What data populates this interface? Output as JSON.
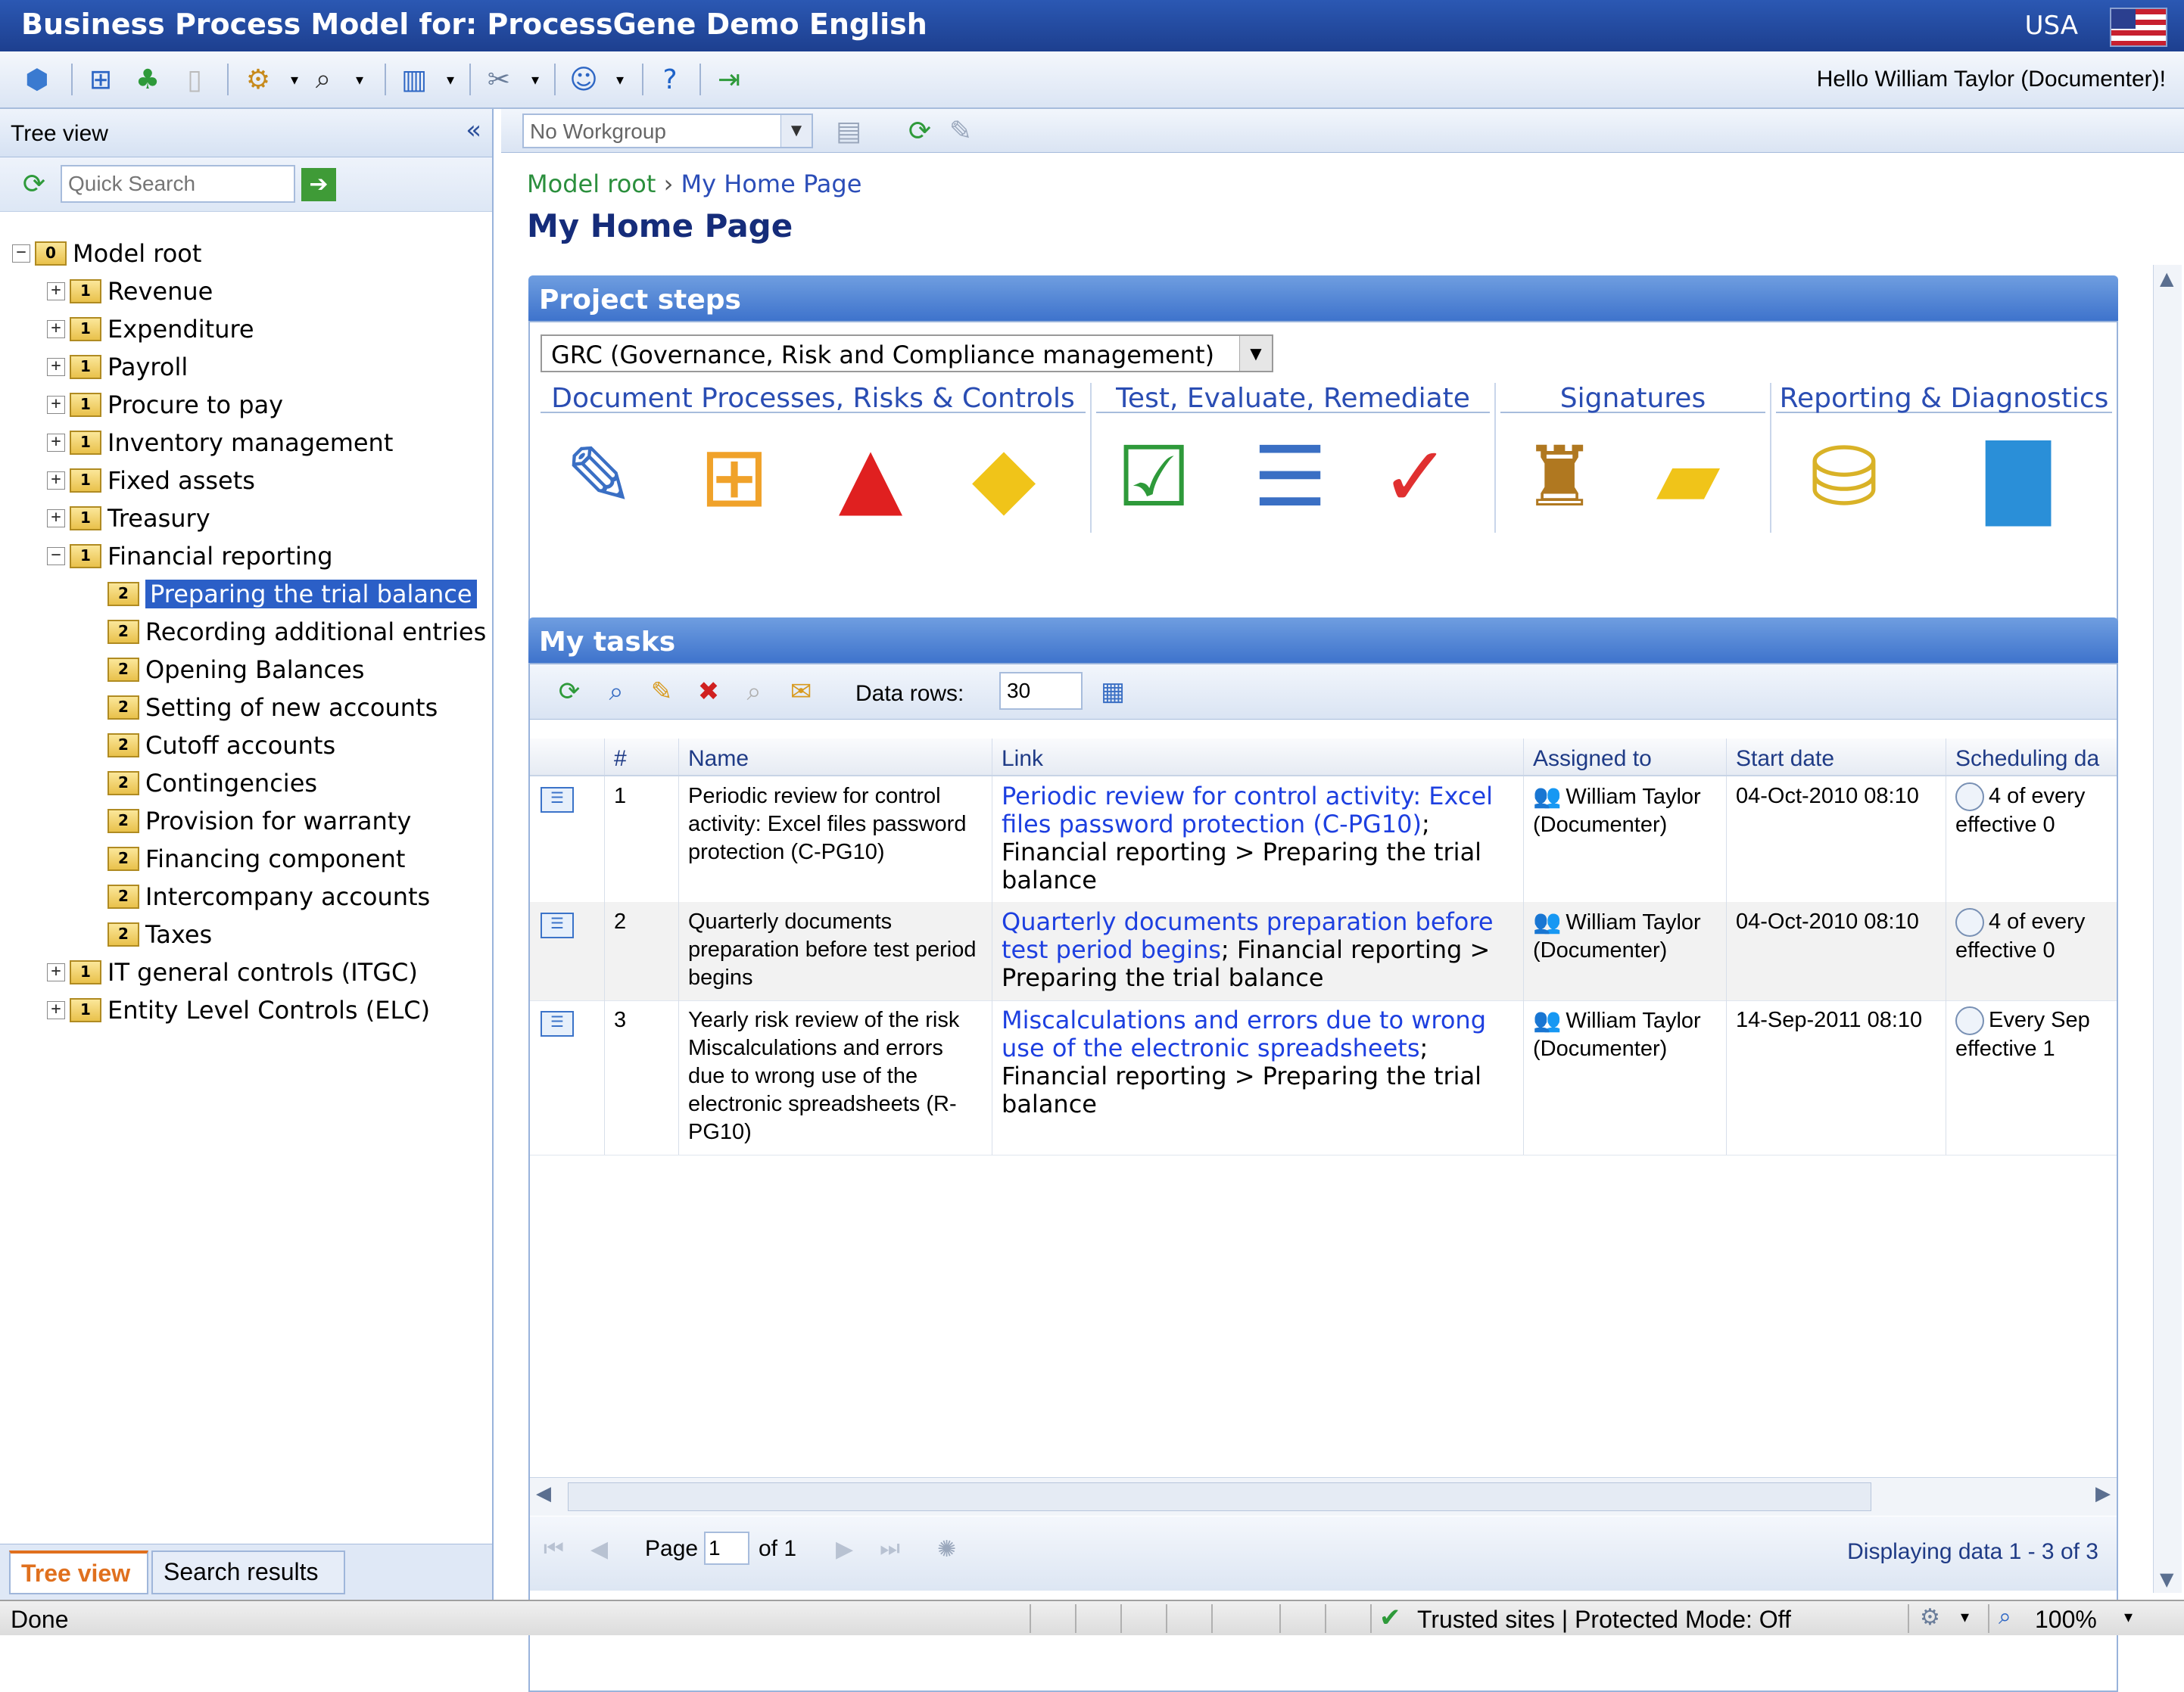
{
  "window": {
    "title": "Business Process Model for: ProcessGene Demo English",
    "locale": "USA",
    "greeting": "Hello William Taylor (Documenter)!"
  },
  "tree": {
    "header": "Tree view",
    "collapse_icon": "«",
    "quick_search_placeholder": "Quick Search",
    "root": {
      "label": "Model root",
      "level": "0"
    },
    "level1": [
      {
        "label": "Revenue",
        "level": "1"
      },
      {
        "label": "Expenditure",
        "level": "1"
      },
      {
        "label": "Payroll",
        "level": "1"
      },
      {
        "label": "Procure to pay",
        "level": "1"
      },
      {
        "label": "Inventory management",
        "level": "1"
      },
      {
        "label": "Fixed assets",
        "level": "1"
      },
      {
        "label": "Treasury",
        "level": "1"
      },
      {
        "label": "Financial reporting",
        "level": "1"
      }
    ],
    "financial_children": [
      {
        "label": "Preparing the trial balance",
        "level": "2"
      },
      {
        "label": "Recording additional entries",
        "level": "2"
      },
      {
        "label": "Opening Balances",
        "level": "2"
      },
      {
        "label": "Setting of new accounts",
        "level": "2"
      },
      {
        "label": "Cutoff accounts",
        "level": "2"
      },
      {
        "label": "Contingencies",
        "level": "2"
      },
      {
        "label": "Provision for warranty",
        "level": "2"
      },
      {
        "label": "Financing component",
        "level": "2"
      },
      {
        "label": "Intercompany accounts",
        "level": "2"
      },
      {
        "label": "Taxes",
        "level": "2"
      }
    ],
    "level1_tail": [
      {
        "label": "IT general controls (ITGC)",
        "level": "1"
      },
      {
        "label": "Entity Level Controls (ELC)",
        "level": "1"
      }
    ],
    "tabs": {
      "tree": "Tree view",
      "search": "Search results"
    }
  },
  "workgroup": {
    "value": "No Workgroup"
  },
  "breadcrumb": {
    "root": "Model root",
    "sep": "›",
    "current": "My Home Page"
  },
  "page_title": "My Home Page",
  "project_steps": {
    "header": "Project steps",
    "selected_method": "GRC (Governance, Risk and Compliance management)",
    "groups": [
      "Document Processes, Risks & Controls",
      "Test, Evaluate, Remediate",
      "Signatures",
      "Reporting & Diagnostics"
    ]
  },
  "tasks": {
    "header": "My tasks",
    "data_rows_label": "Data rows:",
    "data_rows_value": "30",
    "columns": [
      "#",
      "Name",
      "Link",
      "Assigned to",
      "Start date",
      "Scheduling da"
    ],
    "rows": [
      {
        "num": "1",
        "name": "Periodic review for control activity: Excel files password protection (C-PG10)",
        "link_text": "Periodic review for control activity: Excel files password protection (C-PG10)",
        "link_path": "; Financial reporting > Preparing the trial balance",
        "assigned": "William Taylor (Documenter)",
        "start": "04-Oct-2010 08:10",
        "sched": "4 of every effective 0"
      },
      {
        "num": "2",
        "name": "Quarterly documents preparation before test period begins",
        "link_text": "Quarterly documents preparation before test period begins",
        "link_path": "; Financial reporting > Preparing the trial balance",
        "assigned": "William Taylor (Documenter)",
        "start": "04-Oct-2010 08:10",
        "sched": "4 of every effective 0"
      },
      {
        "num": "3",
        "name": "Yearly risk review of the risk Miscalculations and errors due to wrong use of the electronic spreadsheets (R-PG10)",
        "link_text": "Miscalculations and errors due to wrong use of the electronic spreadsheets",
        "link_path": "; Financial reporting > Preparing the trial balance",
        "assigned": "William Taylor (Documenter)",
        "start": "14-Sep-2011 08:10",
        "sched": "Every Sep effective 1"
      }
    ],
    "pager": {
      "page_label": "Page",
      "page_value": "1",
      "of_label": "of 1",
      "displaying": "Displaying data 1 - 3 of 3"
    }
  },
  "statusbar": {
    "left": "Done",
    "security": "Trusted sites | Protected Mode: Off",
    "zoom": "100%"
  },
  "colors": {
    "title_bar": "#1d3f8f",
    "panel_header": "#3e73cc",
    "selection": "#2b5fc7",
    "link": "#1d3fe0",
    "breadcrumb_root": "#2b8f3d"
  }
}
